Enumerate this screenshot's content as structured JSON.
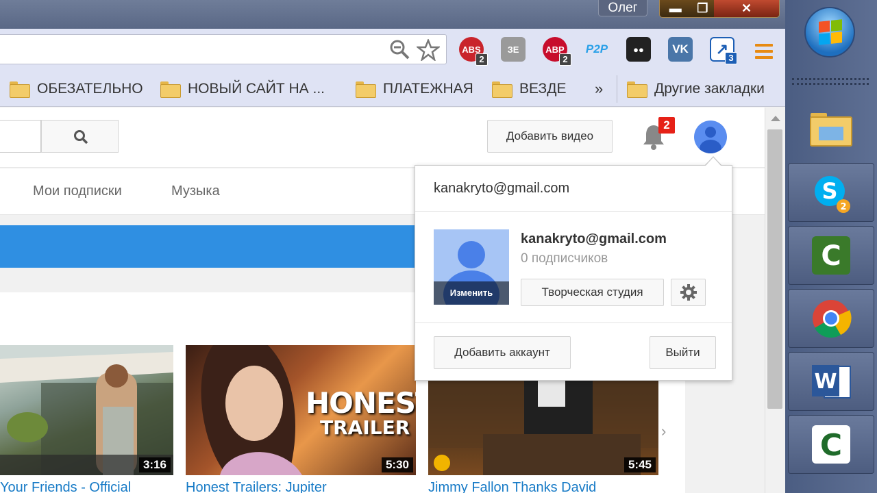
{
  "window": {
    "user_name": "Олег",
    "minimize": "▬",
    "maximize": "❐",
    "close": "✕"
  },
  "extensions": [
    {
      "name": "abs",
      "label": "ABS",
      "badge": "2",
      "color": "#c9242b"
    },
    {
      "name": "wikip",
      "label": "ЗЕ",
      "badge": "",
      "color": "#9a9a9a"
    },
    {
      "name": "adblock-plus",
      "label": "ABP",
      "badge": "2",
      "color": "#c70d2c"
    },
    {
      "name": "p2p",
      "label": "P2P",
      "badge": "",
      "color": "#2aa0e8"
    },
    {
      "name": "ghostery",
      "label": "●●",
      "badge": "",
      "color": "#222"
    },
    {
      "name": "vk",
      "label": "VK",
      "badge": "",
      "color": "#4a76a8"
    },
    {
      "name": "shortcut",
      "label": "↗",
      "badge": "3",
      "color": "#1d5fb5"
    }
  ],
  "bookmarks": [
    {
      "label": "ОБЕЗАТЕЛЬНО"
    },
    {
      "label": "НОВЫЙ САЙТ НА ..."
    },
    {
      "label": "ПЛАТЕЖНАЯ"
    },
    {
      "label": "ВЕЗДЕ"
    }
  ],
  "bookmarks_overflow": "»",
  "other_bookmarks": "Другие закладки",
  "youtube": {
    "upload_label": "Добавить видео",
    "notification_count": "2",
    "nav_tabs": [
      "Мои подписки",
      "Музыка"
    ]
  },
  "videos": [
    {
      "duration": "3:16",
      "title": "Your Friends - Official"
    },
    {
      "duration": "5:30",
      "title": "Honest Trailers: Jupiter",
      "overlay_line1": "HONEST",
      "overlay_line2": "TRAILER"
    },
    {
      "duration": "5:45",
      "title": "Jimmy Fallon Thanks David"
    }
  ],
  "account_popup": {
    "header_email": "kanakryto@gmail.com",
    "change_label": "Изменить",
    "account_email": "kanakryto@gmail.com",
    "subscribers": "0 подписчиков",
    "studio_label": "Творческая студия",
    "add_account_label": "Добавить аккаунт",
    "sign_out_label": "Выйти"
  }
}
